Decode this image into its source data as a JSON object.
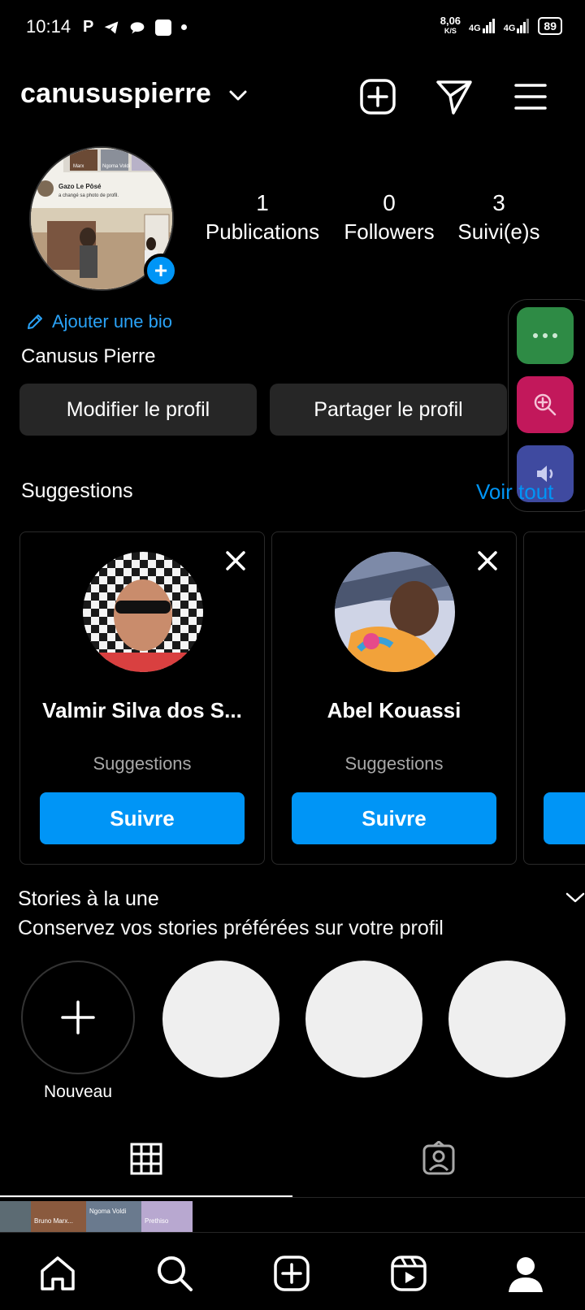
{
  "status_bar": {
    "time": "10:14",
    "net_speed_top": "8,06",
    "net_speed_bottom": "K/S",
    "signal1": "4G",
    "signal2": "4G",
    "battery": "89"
  },
  "header": {
    "username": "canususpierre",
    "icons": [
      "create-post-icon",
      "direct-message-icon",
      "menu-icon"
    ]
  },
  "profile": {
    "stats": [
      {
        "value": "1",
        "label": "Publications"
      },
      {
        "value": "0",
        "label": "Followers"
      },
      {
        "value": "3",
        "label": "Suivi(e)s"
      }
    ],
    "add_bio": "Ajouter une bio",
    "full_name": "Canusus Pierre",
    "edit_button": "Modifier le profil",
    "share_button": "Partager le profil",
    "avatar_post": {
      "author": "Gazo Le Pôsé",
      "text": "a changé sa photo de profil.",
      "tags": [
        "Marx",
        "Ngoma Voldi"
      ]
    }
  },
  "suggestions": {
    "title": "Suggestions",
    "see_all": "Voir tout",
    "cards": [
      {
        "name": "Valmir Silva dos S...",
        "subtitle": "Suggestions",
        "button": "Suivre"
      },
      {
        "name": "Abel Kouassi",
        "subtitle": "Suggestions",
        "button": "Suivre"
      }
    ]
  },
  "stories": {
    "title": "Stories à la une",
    "subtitle": "Conservez vos stories préférées sur votre profil",
    "new_label": "Nouveau"
  },
  "thumb_strip": {
    "labels": [
      "Bruno Marx...",
      "Ngoma Voldi",
      "Prethiso"
    ]
  },
  "colors": {
    "accent": "#0095f6",
    "background": "#000000",
    "button_bg": "#262626",
    "side_green": "#2e8b45",
    "side_magenta": "#c2185b",
    "side_indigo": "#3f4aa0"
  },
  "bottom_nav": [
    "home-icon",
    "search-icon",
    "create-icon",
    "reels-icon",
    "profile-icon"
  ]
}
